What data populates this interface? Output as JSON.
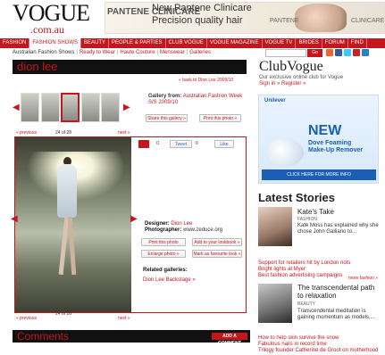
{
  "header": {
    "logo": "VOGUE",
    "logo_sub": ".com.au"
  },
  "ad": {
    "brand": "PANTENE CLINICARE",
    "headline": "New Pantene Clinicare",
    "tagline": "Precision quality hair",
    "product1": "PANTENE",
    "product2": "CLINICARE"
  },
  "nav": [
    "FASHION",
    "FASHION SHOWS",
    "BEAUTY",
    "PEOPLE & PARTIES",
    "CLUB VOGUE",
    "VOGUE MAGAZINE",
    "VOGUE TV",
    "BRIDES",
    "FORUM",
    "FIND"
  ],
  "subnav": {
    "lead": "Australian Fashion Shows",
    "links": [
      "Ready to Wear",
      "Haute Couture",
      "Menswear",
      "Galleries"
    ]
  },
  "search": {
    "button": "Go"
  },
  "gallery": {
    "title": "dion lee",
    "back_link": "« back to Dion Lee 2009/10",
    "count_top": "24 of 28",
    "count_bottom": "24 of 28",
    "prev": "« previous",
    "next": "next »",
    "from_label": "Gallery from:",
    "from_value": "Australian Fashion Week S/S 2009/10",
    "share_btn": "Share this gallery »",
    "print_btn": "Print this photo »",
    "like_count": "0",
    "tweet_label": "Tweet",
    "tweet_count": "0",
    "fb_like": "Like",
    "designer_label": "Designer:",
    "designer": "Dion Lee",
    "photographer_label": "Photographer:",
    "photographer": "www.zeduce.org",
    "buttons": [
      "Print this photo",
      "Add to your lookbook »",
      "Enlarge photo »",
      "Mark as favourite look »"
    ],
    "related_label": "Related galleries:",
    "related_link": "Dion Lee Backstage »"
  },
  "clubvogue": {
    "title": "ClubVogue",
    "desc": "Our exclusive online club for Vogue",
    "signin": "Sign in » Register »"
  },
  "ad2": {
    "brand": "Unilever",
    "new": "NEW",
    "line1": "Dove Foaming",
    "line2": "Make-Up Remover",
    "cta": "CLICK HERE FOR MORE INFO"
  },
  "latest": {
    "title": "Latest Stories",
    "story1": {
      "title": "Kate's Take",
      "category": "FASHION",
      "desc": "Kate Moss has explained why she chose John Galliano to...",
      "list": [
        "Support for retailers hit by London riots",
        "Bright lights at Myer",
        "Best fashion advertising campaigns"
      ],
      "more": "more fashion »"
    },
    "story2": {
      "title": "The transcendental path to relaxation",
      "category": "BEAUTY",
      "desc": "Transcendental meditation is gaining momentum as models,...",
      "list": [
        "How to help skin survive the snow",
        "Fabulous nails in record time",
        "Trilogy founder Catherine de Groot on motherhood"
      ]
    }
  },
  "comments": {
    "title": "Comments",
    "add": "ADD A COMMENT"
  },
  "colors": {
    "brand_red": "#c4161c",
    "black": "#111111"
  }
}
